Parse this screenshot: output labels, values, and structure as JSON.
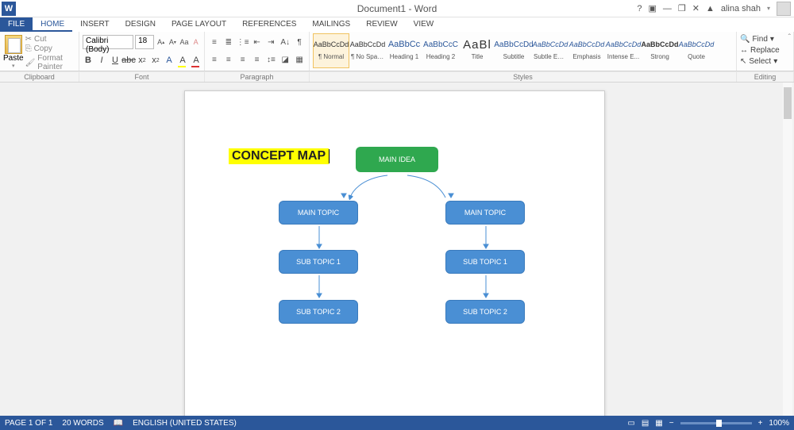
{
  "titlebar": {
    "doc_title": "Document1 - Word",
    "username": "alina shah",
    "help": "?",
    "ribbon_opts": "▣",
    "minimize": "—",
    "restore": "❐",
    "close": "✕"
  },
  "tabs": {
    "file": "FILE",
    "home": "HOME",
    "insert": "INSERT",
    "design": "DESIGN",
    "page_layout": "PAGE LAYOUT",
    "references": "REFERENCES",
    "mailings": "MAILINGS",
    "review": "REVIEW",
    "view": "VIEW"
  },
  "clipboard": {
    "paste": "Paste",
    "cut": "Cut",
    "copy": "Copy",
    "format_painter": "Format Painter",
    "label": "Clipboard"
  },
  "font": {
    "family": "Calibri (Body)",
    "size": "18",
    "label": "Font"
  },
  "paragraph": {
    "label": "Paragraph"
  },
  "styles": {
    "label": "Styles",
    "items": [
      {
        "preview": "AaBbCcDd",
        "name": "¶ Normal",
        "cls": ""
      },
      {
        "preview": "AaBbCcDd",
        "name": "¶ No Spac...",
        "cls": ""
      },
      {
        "preview": "AaBbCc",
        "name": "Heading 1",
        "cls": "h1"
      },
      {
        "preview": "AaBbCcC",
        "name": "Heading 2",
        "cls": "h2"
      },
      {
        "preview": "AaBl",
        "name": "Title",
        "cls": "title"
      },
      {
        "preview": "AaBbCcDd",
        "name": "Subtitle",
        "cls": "h2"
      },
      {
        "preview": "AaBbCcDd",
        "name": "Subtle Em...",
        "cls": "em"
      },
      {
        "preview": "AaBbCcDd",
        "name": "Emphasis",
        "cls": "em"
      },
      {
        "preview": "AaBbCcDd",
        "name": "Intense E...",
        "cls": "em"
      },
      {
        "preview": "AaBbCcDd",
        "name": "Strong",
        "cls": "strong"
      },
      {
        "preview": "AaBbCcDd",
        "name": "Quote",
        "cls": "em"
      }
    ]
  },
  "editing": {
    "find": "Find",
    "replace": "Replace",
    "select": "Select",
    "label": "Editing"
  },
  "document": {
    "title_text": "CONCEPT MAP",
    "main_idea": "MAIN IDEA",
    "left": {
      "topic": "MAIN TOPIC",
      "sub1": "SUB TOPIC 1",
      "sub2": "SUB TOPIC 2"
    },
    "right": {
      "topic": "MAIN TOPIC",
      "sub1": "SUB TOPIC 1",
      "sub2": "SUB TOPIC 2"
    }
  },
  "statusbar": {
    "page": "PAGE 1 OF 1",
    "words": "20 WORDS",
    "lang": "ENGLISH (UNITED STATES)",
    "zoom": "100%"
  }
}
